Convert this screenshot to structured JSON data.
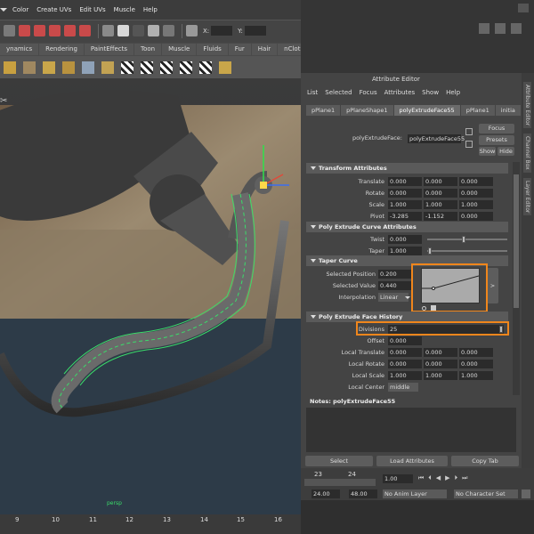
{
  "menubar": {
    "items": [
      "Color",
      "Create UVs",
      "Edit UVs",
      "Muscle",
      "Help"
    ]
  },
  "toolbar": {
    "x_label": "X:",
    "y_label": "Y:"
  },
  "shelf_tabs": [
    "ynamics",
    "Rendering",
    "PaintEffects",
    "Toon",
    "Muscle",
    "Fluids",
    "Fur",
    "Hair",
    "nCloth",
    "Cu"
  ],
  "side_tabs": [
    "Attribute Editor",
    "Channel Box",
    "Layer Editor"
  ],
  "attr_editor": {
    "title": "Attribute Editor",
    "menu": [
      "List",
      "Selected",
      "Focus",
      "Attributes",
      "Show",
      "Help"
    ],
    "node_tabs": [
      "pPlane1",
      "pPlaneShape1",
      "polyExtrudeFace55",
      "pPlane1",
      "initia"
    ],
    "active_tab_index": 2,
    "node_label": "polyExtrudeFace:",
    "node_value": "polyExtrudeFace55",
    "focus_label": "Focus",
    "presets_label": "Presets",
    "show_label": "Show",
    "hide_label": "Hide",
    "sections": {
      "transform": "Transform Attributes",
      "curve": "Poly Extrude Curve Attributes",
      "taper": "Taper Curve",
      "history": "Poly Extrude Face History"
    },
    "translate": {
      "label": "Translate",
      "values": [
        "0.000",
        "0.000",
        "0.000"
      ]
    },
    "rotate": {
      "label": "Rotate",
      "values": [
        "0.000",
        "0.000",
        "0.000"
      ]
    },
    "scale": {
      "label": "Scale",
      "values": [
        "1.000",
        "1.000",
        "1.000"
      ]
    },
    "pivot": {
      "label": "Pivot",
      "values": [
        "-3.285",
        "-1.152",
        "0.000"
      ]
    },
    "twist": {
      "label": "Twist",
      "value": "0.000"
    },
    "taper_field": {
      "label": "Taper",
      "value": "1.000"
    },
    "selected_position": {
      "label": "Selected Position",
      "value": "0.200"
    },
    "selected_value": {
      "label": "Selected Value",
      "value": "0.440"
    },
    "interpolation": {
      "label": "Interpolation",
      "value": "Linear"
    },
    "divisions": {
      "label": "Divisions",
      "value": "25"
    },
    "offset": {
      "label": "Offset",
      "value": "0.000"
    },
    "local_translate": {
      "label": "Local Translate",
      "values": [
        "0.000",
        "0.000",
        "0.000"
      ]
    },
    "local_rotate": {
      "label": "Local Rotate",
      "values": [
        "0.000",
        "0.000",
        "0.000"
      ]
    },
    "local_scale": {
      "label": "Local Scale",
      "values": [
        "1.000",
        "1.000",
        "1.000"
      ]
    },
    "local_center": {
      "label": "Local Center",
      "value": "middle"
    },
    "notes_label": "Notes:  polyExtrudeFace55",
    "select_btn": "Select",
    "load_btn": "Load Attributes",
    "copy_btn": "Copy Tab"
  },
  "timeline": {
    "ticks": [
      "23",
      "24"
    ],
    "current_frame": "1.00",
    "start": "24.00",
    "end": "48.00",
    "anim_layer": "No Anim Layer",
    "char_set": "No Character Set"
  },
  "ruler": {
    "ticks": [
      "9",
      "10",
      "11",
      "12",
      "13",
      "14",
      "15",
      "16"
    ]
  },
  "viewport": {
    "label": "persp"
  },
  "colors": {
    "accent": "#f0861c",
    "wire": "#3bdc6a"
  }
}
